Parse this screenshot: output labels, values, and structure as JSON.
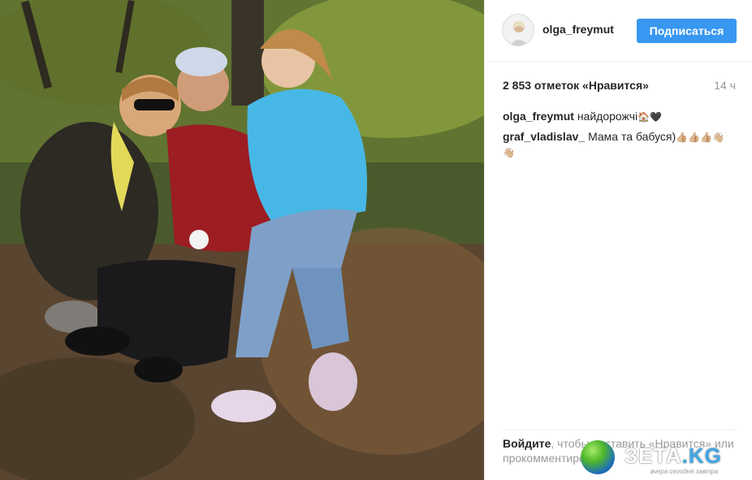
{
  "post": {
    "photo_alt": "photo",
    "username": "olga_freymut",
    "follow_label": "Подписаться",
    "likes_text": "2 853 отметок «Нравится»",
    "time_text": "14 ч"
  },
  "comments": [
    {
      "user": "olga_freymut",
      "text": "найдорожчі",
      "emoji": "🏠🖤"
    },
    {
      "user": "graf_vladislav_",
      "text": "Мама та бабуся)",
      "emoji": "👍🏼👍🏼👍🏼👋🏼 👋🏼"
    }
  ],
  "footer": {
    "login_link": "Войдите",
    "text_a": ", чтобы поставить «Нравится» или прокомментировать."
  },
  "watermark": {
    "brand": "ЗЕТА",
    "tld": ".KG",
    "tagline": "вчера сегодня завтра"
  },
  "colors": {
    "accent": "#3897f0",
    "text": "#262626",
    "muted": "#999999"
  }
}
